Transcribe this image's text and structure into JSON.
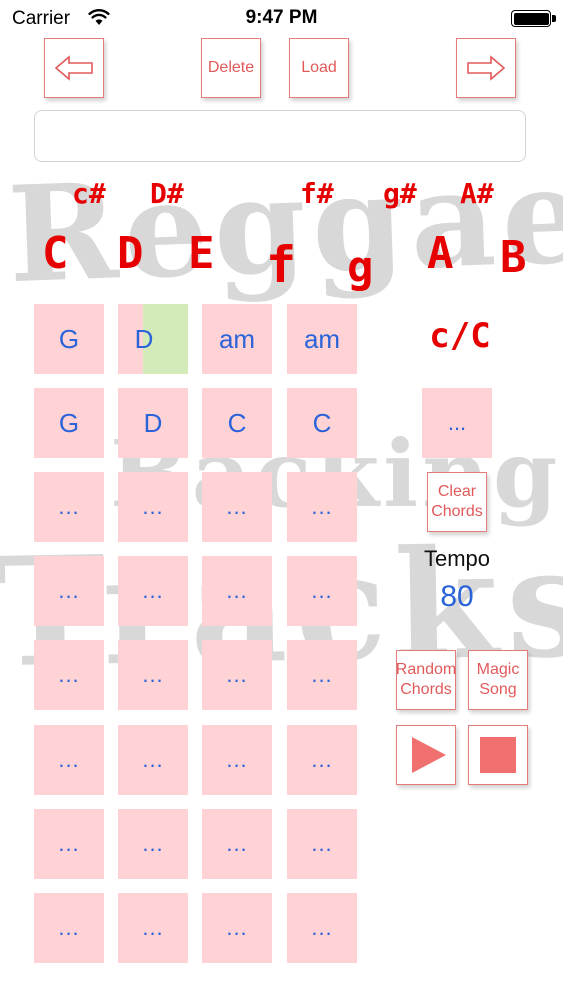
{
  "status_bar": {
    "carrier": "Carrier",
    "time": "9:47 PM"
  },
  "toolbar": {
    "back_icon": "left-arrow-icon",
    "delete_label": "Delete",
    "load_label": "Load",
    "forward_icon": "right-arrow-icon"
  },
  "song_field": {
    "value": "",
    "placeholder": ""
  },
  "watermark": {
    "line1": "Reggae",
    "line2": "Backing",
    "line3": "Tracks"
  },
  "keys": {
    "naturals": [
      "C",
      "D",
      "E",
      "f",
      "g",
      "A",
      "B"
    ],
    "sharps": [
      "c#",
      "D#",
      "f#",
      "g#",
      "A#"
    ]
  },
  "grid": {
    "rows": [
      [
        "G",
        "D",
        "am",
        "am"
      ],
      [
        "G",
        "D",
        "C",
        "C"
      ],
      [
        "...",
        "...",
        "...",
        "..."
      ],
      [
        "...",
        "...",
        "...",
        "..."
      ],
      [
        "...",
        "...",
        "...",
        "..."
      ],
      [
        "...",
        "...",
        "...",
        "..."
      ],
      [
        "...",
        "...",
        "...",
        "..."
      ],
      [
        "...",
        "...",
        "...",
        "..."
      ]
    ],
    "active_cell": "D"
  },
  "side_panel": {
    "key_label": "c/C",
    "extra_slot": "...",
    "clear_label": "Clear Chords",
    "tempo_label": "Tempo",
    "tempo_value": "80",
    "random_label": "Random Chords",
    "magic_label": "Magic Song",
    "play_icon": "play-icon",
    "stop_icon": "stop-icon"
  },
  "colors": {
    "accent_red": "#e60000",
    "button_red": "#e15a5a",
    "cell_pink": "#ffd2d6",
    "chord_blue": "#2b63d9",
    "active_green": "#c6e6b0"
  }
}
